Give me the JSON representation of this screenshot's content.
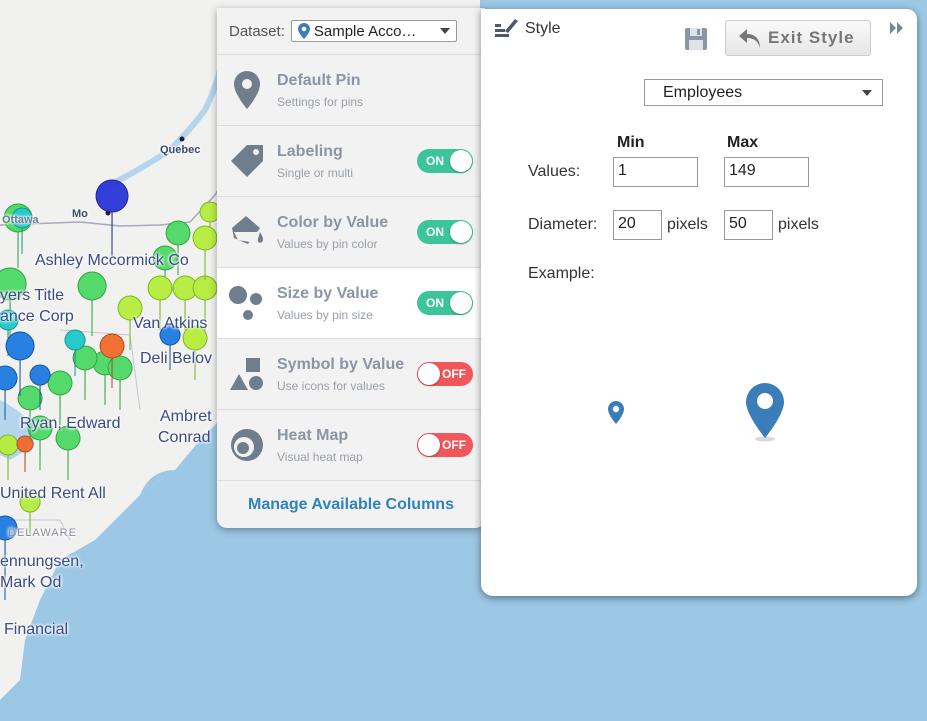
{
  "map": {
    "labels": {
      "quebec": "Quebec",
      "ottawa": "Ottawa",
      "montreal": "Mo",
      "ashley": "Ashley Mccormick Co",
      "ayers1": "yers Title",
      "ayers2": "ance Corp",
      "van": "Van Atkins",
      "deli": "Deli Belov",
      "ambret": "Ambret",
      "conrad": "Conrad",
      "ryan": "Ryan, Edward",
      "united": "United Rent All",
      "delaware": "DELAWARE",
      "henn1": "ennungsen,",
      "henn2": "Mark Od",
      "financial": "Financial"
    }
  },
  "menu": {
    "dataset_label": "Dataset:",
    "dataset_value": "Sample Acco…",
    "items": [
      {
        "title": "Default Pin",
        "subtitle": "Settings for pins",
        "icon": "pin-icon"
      },
      {
        "title": "Labeling",
        "subtitle": "Single or multi",
        "icon": "tag-icon",
        "toggle": "ON"
      },
      {
        "title": "Color by Value",
        "subtitle": "Values by pin color",
        "icon": "paint-bucket-icon",
        "toggle": "ON"
      },
      {
        "title": "Size by Value",
        "subtitle": "Values by pin size",
        "icon": "circles-icon",
        "toggle": "ON"
      },
      {
        "title": "Symbol by Value",
        "subtitle": "Use icons for values",
        "icon": "shapes-icon",
        "toggle": "OFF"
      },
      {
        "title": "Heat Map",
        "subtitle": "Visual heat map",
        "icon": "heat-map-icon",
        "toggle": "OFF"
      }
    ],
    "manage_columns": "Manage Available Columns"
  },
  "style_panel": {
    "title": "Style",
    "exit_label": "Exit Style",
    "column_value": "Employees",
    "min_header": "Min",
    "max_header": "Max",
    "values_label": "Values:",
    "values_min": "1",
    "values_max": "149",
    "diameter_label": "Diameter:",
    "diameter_min": "20",
    "diameter_max": "50",
    "pixels_unit": "pixels",
    "example_label": "Example:"
  },
  "colors": {
    "toggle_on": "#3cc49a",
    "toggle_off": "#f0575a",
    "link": "#2e84b8",
    "pin_blue": "#3a7db8",
    "icon_gray": "#6f7d8c"
  }
}
